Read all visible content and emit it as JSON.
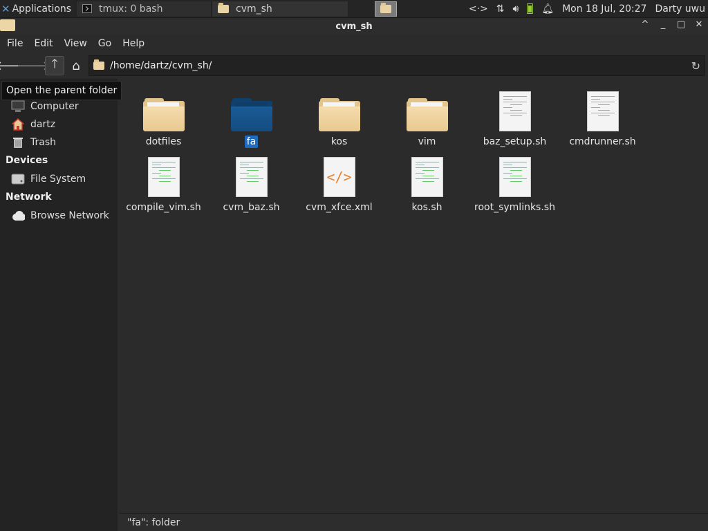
{
  "panel": {
    "apps_label": "Applications",
    "tasks": [
      {
        "label": "tmux: 0 bash",
        "icon": "terminal-icon"
      },
      {
        "label": "cvm_sh",
        "icon": "folder-icon"
      }
    ],
    "tray": {
      "network_label": "<·>",
      "datetime": "Mon 18 Jul, 20:27",
      "user": "Darty uwu"
    }
  },
  "window": {
    "title": "cvm_sh",
    "controls": [
      "^",
      "_",
      "□",
      "✕"
    ]
  },
  "menu": [
    "File",
    "Edit",
    "View",
    "Go",
    "Help"
  ],
  "toolbar": {
    "path": "/home/dartz/cvm_sh/",
    "tooltip": "Open the parent folder"
  },
  "sidebar": {
    "places_items": [
      {
        "label": "Computer",
        "icon": "computer-icon"
      },
      {
        "label": "dartz",
        "icon": "home-icon"
      },
      {
        "label": "Trash",
        "icon": "trash-icon"
      }
    ],
    "devices_heading": "Devices",
    "devices_items": [
      {
        "label": "File System",
        "icon": "drive-icon"
      }
    ],
    "network_heading": "Network",
    "network_items": [
      {
        "label": "Browse Network",
        "icon": "cloud-icon"
      }
    ]
  },
  "files": [
    {
      "name": "dotfiles",
      "type": "folder"
    },
    {
      "name": "fa",
      "type": "folder",
      "selected": true
    },
    {
      "name": "kos",
      "type": "folder"
    },
    {
      "name": "vim",
      "type": "folder"
    },
    {
      "name": "baz_setup.sh",
      "type": "script"
    },
    {
      "name": "cmdrunner.sh",
      "type": "script"
    },
    {
      "name": "compile_vim.sh",
      "type": "script"
    },
    {
      "name": "cvm_baz.sh",
      "type": "script"
    },
    {
      "name": "cvm_xfce.xml",
      "type": "xml"
    },
    {
      "name": "kos.sh",
      "type": "script"
    },
    {
      "name": "root_symlinks.sh",
      "type": "script"
    }
  ],
  "status": "\"fa\": folder",
  "colors": {
    "selection": "#1f6bbf",
    "folder": "#f0d6a5",
    "selected_folder": "#1a5b96"
  }
}
